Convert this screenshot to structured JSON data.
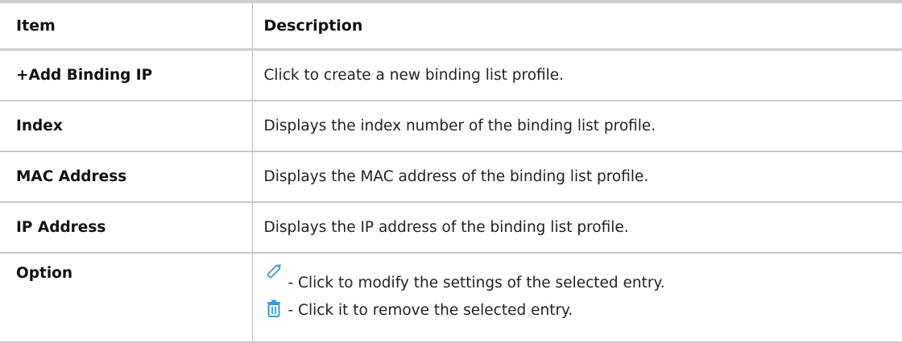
{
  "table": {
    "headers": {
      "item": "Item",
      "description": "Description"
    },
    "rows": [
      {
        "item": "+Add Binding IP",
        "description": "Click to create a new binding list profile."
      },
      {
        "item": "Index",
        "description": "Displays the index number of the binding list profile."
      },
      {
        "item": "MAC Address",
        "description": "Displays the MAC address of the binding list profile."
      },
      {
        "item": "IP Address",
        "description": "Displays the IP address of the binding list profile."
      }
    ],
    "option_row": {
      "item": "Option",
      "lines": [
        {
          "icon": "pencil-icon",
          "text": " - Click to modify the settings of the selected entry."
        },
        {
          "icon": "trash-icon",
          "text": " - Click it to remove the selected entry."
        }
      ]
    }
  },
  "colors": {
    "rule": "#cfcfcf",
    "icon_blue": "#3a9be0"
  }
}
